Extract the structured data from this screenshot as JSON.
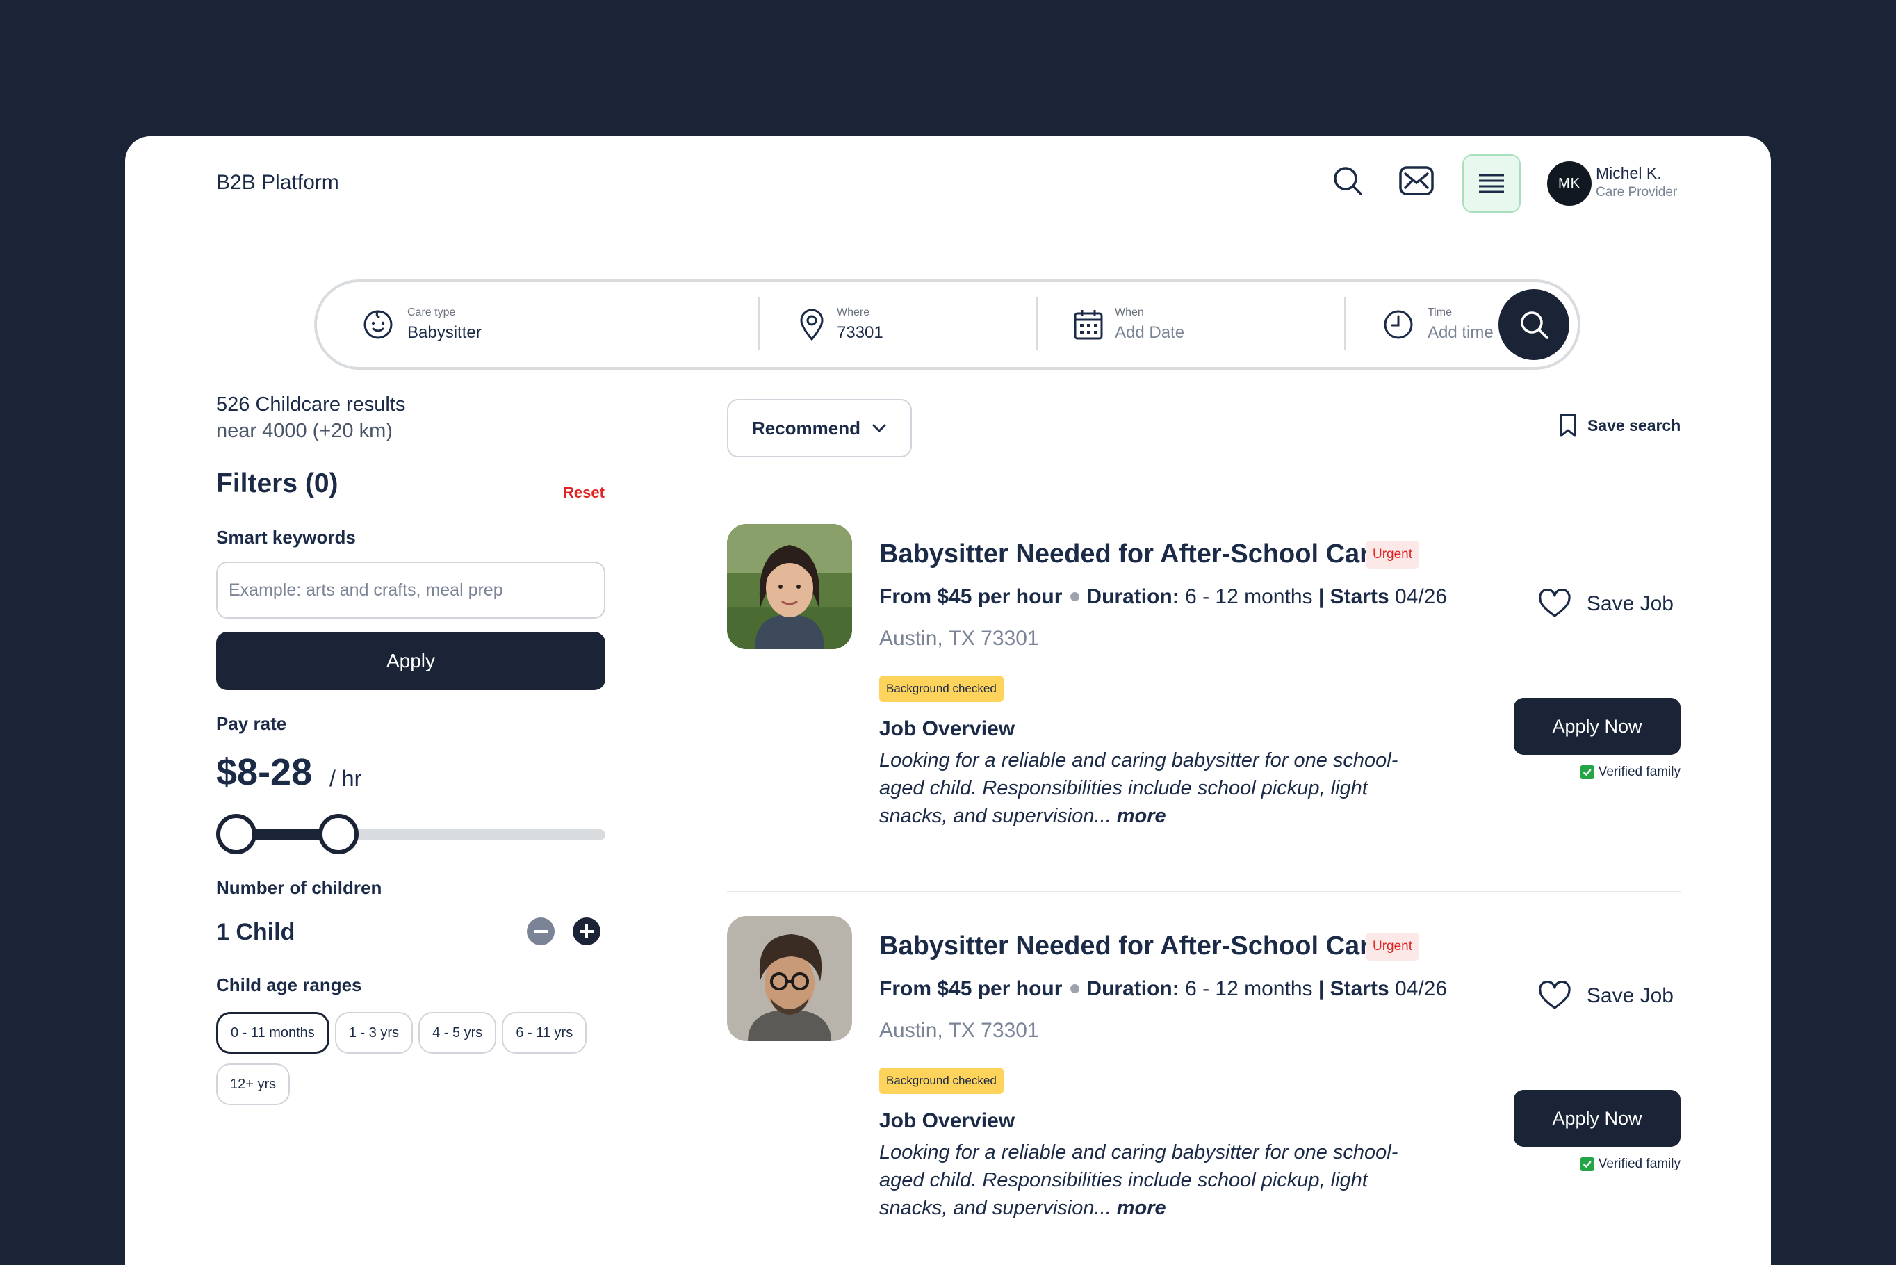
{
  "header": {
    "brand": "B2B Platform",
    "user": {
      "initials": "MK",
      "name": "Michel K.",
      "role": "Care Provider"
    }
  },
  "search": {
    "care_type": {
      "label": "Care type",
      "value": "Babysitter"
    },
    "where": {
      "label": "Where",
      "value": "73301"
    },
    "when": {
      "label": "When",
      "value": "Add Date"
    },
    "time": {
      "label": "Time",
      "value": "Add time"
    }
  },
  "results": {
    "count": "526 Childcare results",
    "near": "near 4000 (+20 km)"
  },
  "filters": {
    "title": "Filters (0)",
    "reset": "Reset",
    "keywords_label": "Smart keywords",
    "keywords_placeholder": "Example: arts and crafts, meal prep",
    "apply": "Apply",
    "pay_label": "Pay rate",
    "pay_value": "$8-28",
    "pay_unit": "/ hr",
    "pay_min": 8,
    "pay_max": 28,
    "children_label": "Number of children",
    "children_value": "1 Child",
    "age_label": "Child age ranges",
    "age_ranges": [
      "0 - 11 months",
      "1 - 3 yrs",
      "4 - 5 yrs",
      "6 - 11 yrs",
      "12+ yrs"
    ],
    "age_selected": "0 - 11 months"
  },
  "sort": {
    "label": "Recommend"
  },
  "save_search": "Save search",
  "jobs": [
    {
      "title": "Babysitter Needed for After-School Care",
      "urgent": "Urgent",
      "rate": "From $45 per hour",
      "duration_label": "Duration:",
      "duration": "6 - 12 months",
      "starts_label": "| Starts",
      "starts": "04/26",
      "location": "Austin, TX 73301",
      "badge": "Background checked",
      "overview_title": "Job Overview",
      "overview": "Looking for a reliable and caring babysitter for one school-aged child. Responsibilities include school pickup, light snacks, and supervision...",
      "more": "more",
      "save_job": "Save Job",
      "apply_now": "Apply Now",
      "verified": "Verified family"
    },
    {
      "title": "Babysitter Needed for After-School Care",
      "urgent": "Urgent",
      "rate": "From $45 per hour",
      "duration_label": "Duration:",
      "duration": "6 - 12 months",
      "starts_label": "| Starts",
      "starts": "04/26",
      "location": "Austin, TX 73301",
      "badge": "Background checked",
      "overview_title": "Job Overview",
      "overview": "Looking for a reliable and caring babysitter for one school-aged child. Responsibilities include school pickup, light snacks, and supervision...",
      "more": "more",
      "save_job": "Save Job",
      "apply_now": "Apply Now",
      "verified": "Verified family"
    }
  ],
  "icons": {
    "search": "search-icon",
    "mail": "mail-icon",
    "menu": "menu-icon",
    "care_type": "baby-face-icon",
    "where": "location-pin-icon",
    "when": "calendar-icon",
    "time": "clock-icon",
    "sort": "chevron-down-icon",
    "save_search": "bookmark-icon",
    "save_job": "heart-icon",
    "verified": "check-icon"
  },
  "colors": {
    "navy": "#1a2436",
    "urgent": "#e02424",
    "badge": "#fdd35c",
    "verified": "#22a447",
    "menu_bg": "#e8f8ee"
  }
}
